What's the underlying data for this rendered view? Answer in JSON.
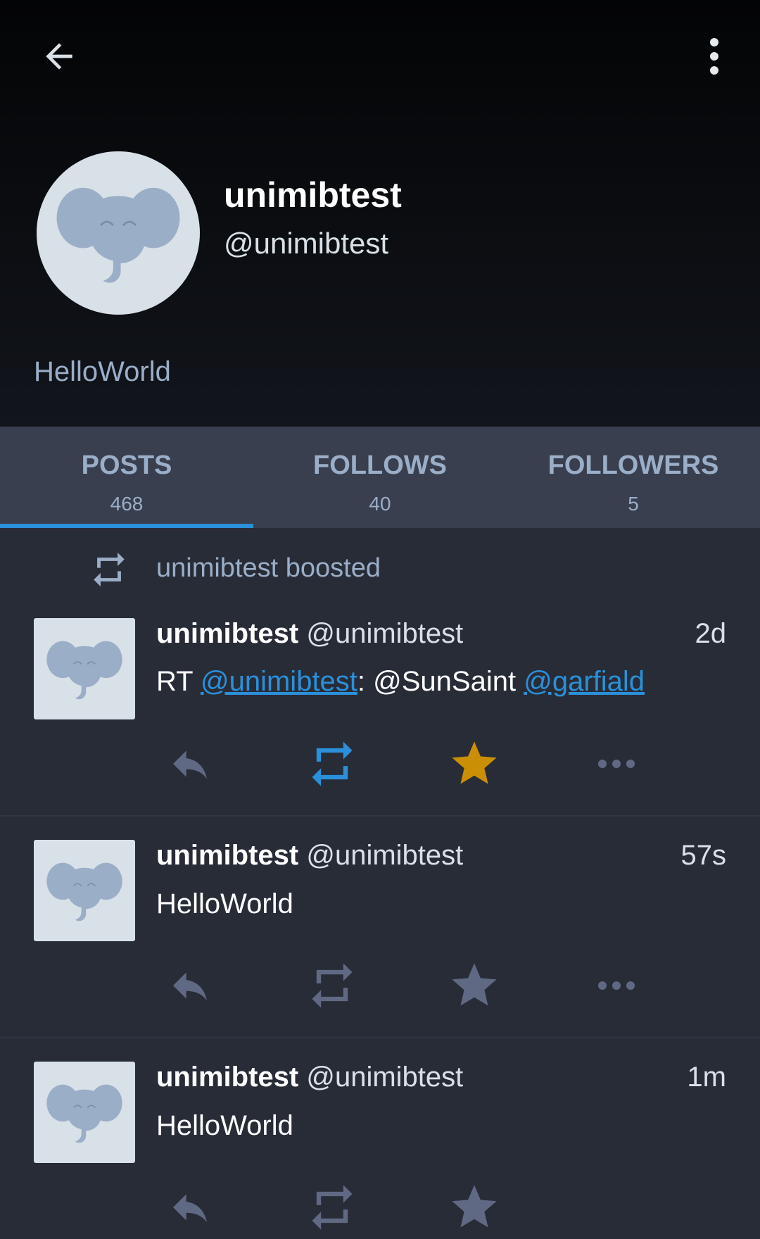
{
  "toolbar": {
    "back_icon": "arrow-left-icon",
    "more_icon": "more-vertical-icon"
  },
  "profile": {
    "display_name": "unimibtest",
    "handle": "@unimibtest",
    "bio": "HelloWorld",
    "avatar_icon": "elephant-avatar-icon"
  },
  "tabs": [
    {
      "label": "POSTS",
      "count": "468",
      "active": true
    },
    {
      "label": "FOLLOWS",
      "count": "40",
      "active": false
    },
    {
      "label": "FOLLOWERS",
      "count": "5",
      "active": false
    }
  ],
  "statuses": [
    {
      "boost_label": "unimibtest boosted",
      "display_name": "unimibtest",
      "acct": "@unimibtest",
      "time": "2d",
      "content": {
        "prefix": "RT ",
        "mention1": "@unimibtest",
        "middle": ": @SunSaint ",
        "mention2": "@garfiald"
      },
      "reblogged": true,
      "favourited": true
    },
    {
      "display_name": "unimibtest",
      "acct": "@unimibtest",
      "time": "57s",
      "content_text": "HelloWorld",
      "reblogged": false,
      "favourited": false
    },
    {
      "display_name": "unimibtest",
      "acct": "@unimibtest",
      "time": "1m",
      "content_text": "HelloWorld",
      "reblogged": false,
      "favourited": false
    }
  ],
  "colors": {
    "accent": "#2b90d9",
    "favourite": "#ca8f04",
    "icon_muted": "#606984",
    "background": "#282c37",
    "tab_bar": "#393f4f"
  }
}
